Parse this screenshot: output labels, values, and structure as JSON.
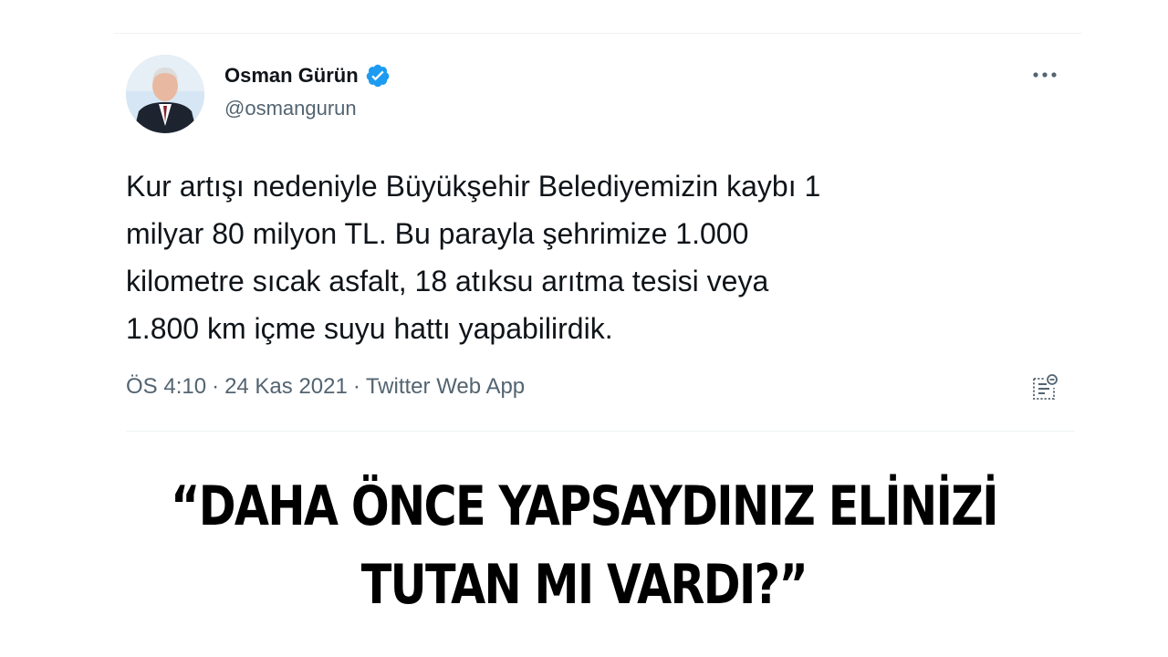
{
  "colors": {
    "text_primary": "#0f1419",
    "text_secondary": "#536471",
    "verified_badge": "#1d9bf0",
    "divider": "#eff3f4",
    "headline": "#000000"
  },
  "tweet": {
    "author": {
      "name": "Osman Gürün",
      "handle": "@osmangurun",
      "verified": true
    },
    "text_lines": [
      "Kur artışı nedeniyle Büyükşehir Belediyemizin kaybı 1",
      "milyar 80 milyon TL. Bu parayla şehrimize 1.000",
      "kilometre sıcak asfalt, 18 atıksu arıtma tesisi veya",
      "1.800 km içme suyu hattı yapabilirdik."
    ],
    "time": "ÖS 4:10",
    "date": "24 Kas 2021",
    "source": "Twitter Web App",
    "separator": "·"
  },
  "icons": {
    "more": "more-dots-icon",
    "analytics": "analytics-icon",
    "verified": "verified-check-icon"
  },
  "headline": {
    "line1": "“DAHA ÖNCE YAPSAYDINIZ ELİNİZİ",
    "line2": "TUTAN MI VARDI?”"
  }
}
